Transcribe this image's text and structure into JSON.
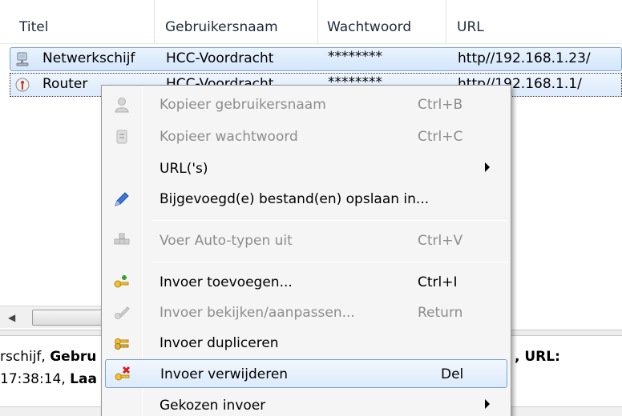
{
  "columns": [
    "Titel",
    "Gebruikersnaam",
    "Wachtwoord",
    "URL"
  ],
  "entries": [
    {
      "title": "Netwerkschijf",
      "username": "HCC-Voordracht",
      "password": "********",
      "url": "http//192.168.1.23/"
    },
    {
      "title": "Router",
      "username": "HCC-Voordracht",
      "password": "********",
      "url": "http//192.168.1.1/"
    }
  ],
  "details": {
    "line1_prefix": "rschijf, ",
    "line1_bold": "Gebru",
    "line1_right": ", URL:",
    "line2_prefix": "17:38:14, ",
    "line2_bold": "Laa"
  },
  "context_menu": {
    "items": [
      {
        "label": "Kopieer gebruikersnaam",
        "shortcut": "Ctrl+B",
        "icon": "user-icon",
        "enabled": false
      },
      {
        "label": "Kopieer wachtwoord",
        "shortcut": "Ctrl+C",
        "icon": "key-icon",
        "enabled": false
      },
      {
        "label": "URL('s)",
        "shortcut": "",
        "icon": "",
        "enabled": true,
        "submenu": true
      },
      {
        "label": "Bijgevoegd(e) bestand(en) opslaan in...",
        "shortcut": "",
        "icon": "pencil-icon",
        "enabled": true
      },
      {
        "label": "Voer Auto-typen uit",
        "shortcut": "Ctrl+V",
        "icon": "autotype-icon",
        "enabled": false
      },
      {
        "label": "Invoer toevoegen...",
        "shortcut": "Ctrl+I",
        "icon": "add-key-icon",
        "enabled": true
      },
      {
        "label": "Invoer bekijken/aanpassen...",
        "shortcut": "Return",
        "icon": "edit-key-icon",
        "enabled": false
      },
      {
        "label": "Invoer dupliceren",
        "shortcut": "",
        "icon": "duplicate-key-icon",
        "enabled": true
      },
      {
        "label": "Invoer verwijderen",
        "shortcut": "Del",
        "icon": "delete-key-icon",
        "enabled": true,
        "highlighted": true
      },
      {
        "label": "Gekozen invoer",
        "shortcut": "",
        "icon": "",
        "enabled": true,
        "submenu": true
      }
    ]
  },
  "colors": {
    "selection_border": "#7da2ce",
    "selection_fill": "#d3e6fb",
    "disabled_text": "#8d8d8d"
  }
}
